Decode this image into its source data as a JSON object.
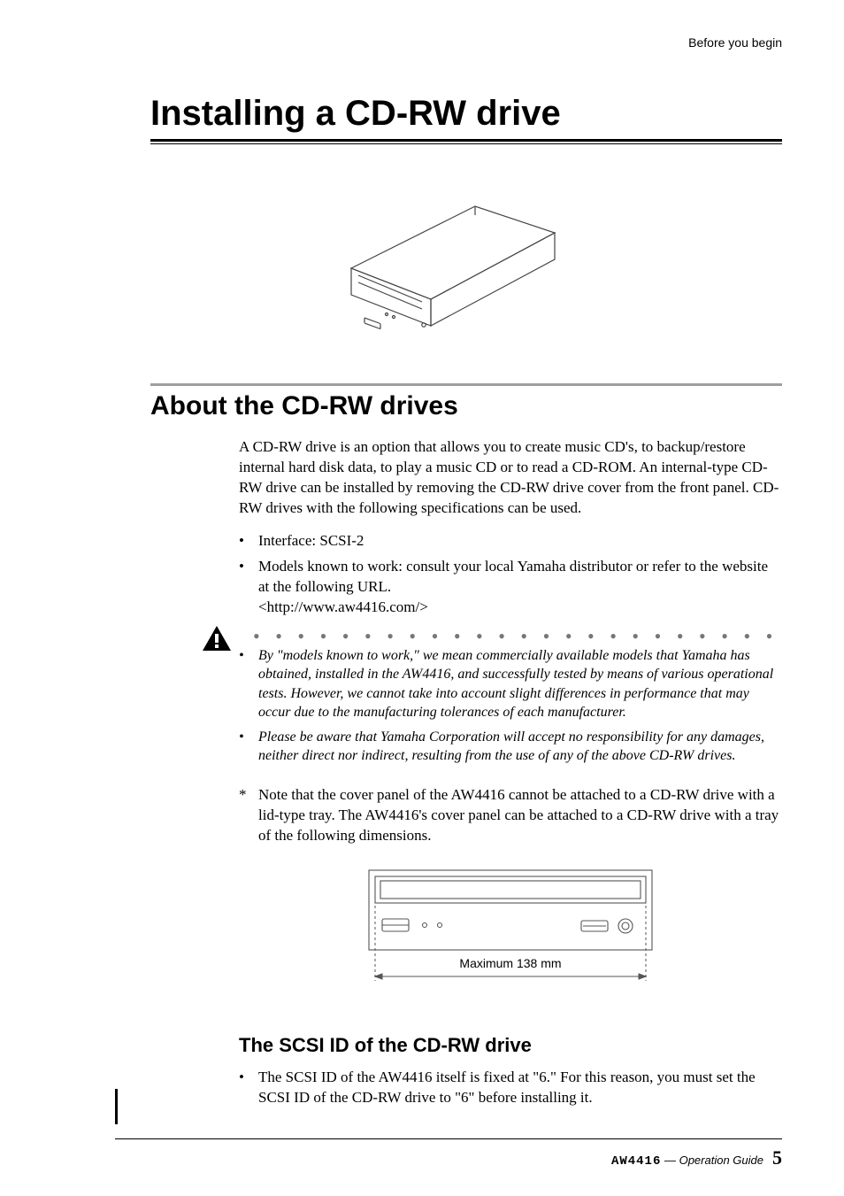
{
  "running_header": "Before you begin",
  "page_title": "Installing a CD-RW drive",
  "section1": {
    "title": "About the CD-RW drives",
    "intro": "A CD-RW drive is an option that allows you to create music CD's, to backup/restore internal hard disk data, to play a music CD or to read a CD-ROM. An internal-type CD-RW drive can be installed by removing the CD-RW drive cover from the front panel. CD-RW drives with the following specifications can be used.",
    "bullets": {
      "b0": "Interface: SCSI-2",
      "b1": "Models known to work: consult your local Yamaha distributor or refer to the website at the following URL.",
      "b1_url": "<http://www.aw4416.com/>"
    },
    "warn": {
      "w0": "By \"models known to work,\" we mean commercially available models that Yamaha has obtained, installed in the AW4416, and successfully tested by means of various operational tests. However, we cannot take into account slight differences in performance that may occur due to the manufacturing tolerances of each manufacturer.",
      "w1": "Please be aware that Yamaha Corporation will accept no responsibility for any damages, neither direct nor indirect, resulting from the use of any of the above CD-RW drives."
    },
    "star_note": "Note that the cover panel of the AW4416 cannot be attached to a CD-RW drive with a lid-type tray. The AW4416's cover panel can be attached to a CD-RW drive with a tray of the following dimensions.",
    "tray_caption": "Maximum 138 mm"
  },
  "subsection1": {
    "title": "The SCSI ID of the CD-RW drive",
    "bullet": "The SCSI ID of the AW4416 itself is fixed at \"6.\" For this reason, you must set the SCSI ID of the CD-RW drive to \"6\" before installing it."
  },
  "footer": {
    "model": "AW4416",
    "separator": " — ",
    "guide": "Operation Guide",
    "page": "5"
  }
}
